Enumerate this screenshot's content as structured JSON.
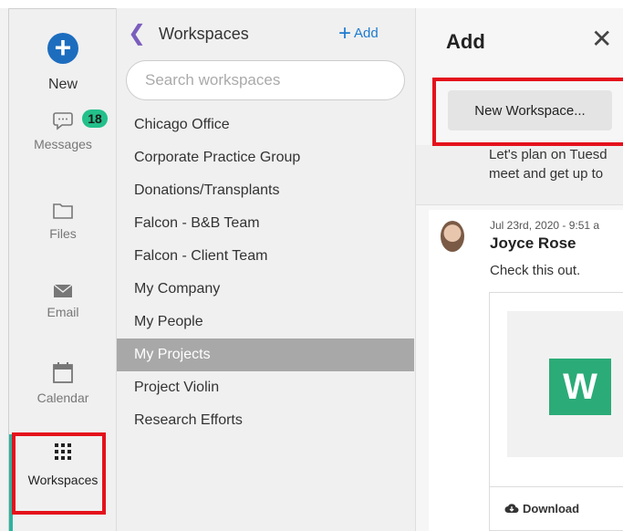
{
  "rail": {
    "new_label": "New",
    "messages_label": "Messages",
    "messages_badge": "18",
    "files_label": "Files",
    "email_label": "Email",
    "calendar_label": "Calendar",
    "workspaces_label": "Workspaces"
  },
  "workspaces": {
    "title": "Workspaces",
    "add_label": "Add",
    "search_placeholder": "Search workspaces",
    "items": [
      "Chicago Office",
      "Corporate Practice Group",
      "Donations/Transplants",
      "Falcon - B&B Team",
      "Falcon - Client Team",
      "My Company",
      "My People",
      "My Projects",
      "Project Violin",
      "Research Efforts"
    ],
    "selected": "My Projects"
  },
  "add_panel": {
    "title": "Add",
    "close_glyph": "✕",
    "new_workspace_label": "New Workspace...",
    "preview_line1": "Let's plan on Tuesd",
    "preview_line2": "meet and get up to",
    "post_date": "Jul 23rd, 2020 - 9:51 a",
    "post_author": "Joyce Rose",
    "post_body": "Check this out.",
    "attachment_letter": "W",
    "download_label": "Download"
  },
  "colors": {
    "accent_blue": "#1d6dbf",
    "badge_green": "#23c08a",
    "active_teal": "#2bb3a0",
    "highlight_red": "#e4111b",
    "word_green": "#2bab77"
  }
}
